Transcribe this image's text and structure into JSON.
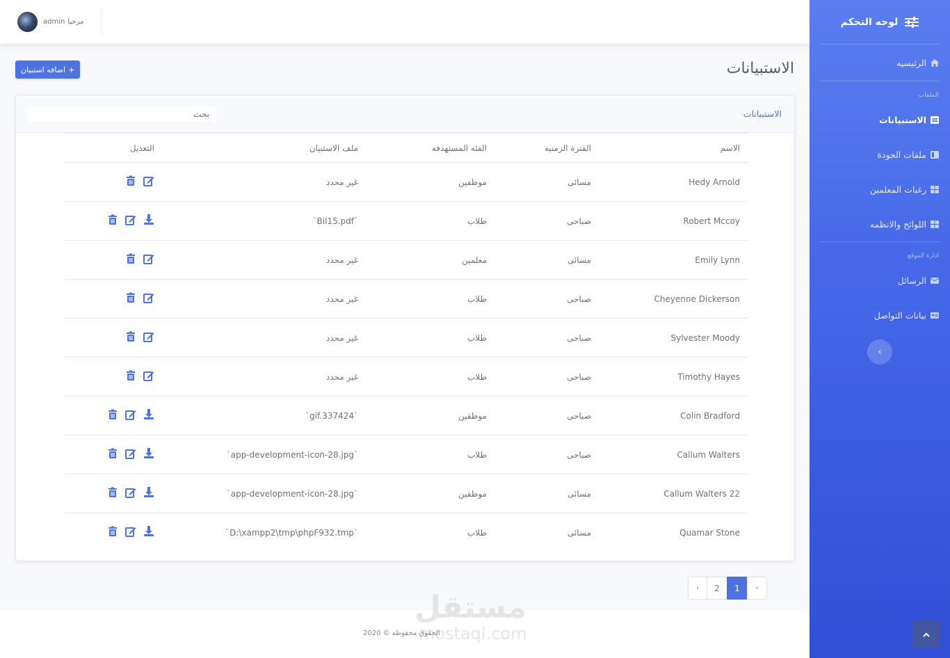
{
  "app": {
    "brand_label": "لوحه التحكم"
  },
  "sidebar": {
    "home_label": "الرئيسيه",
    "section_files": "الملفات",
    "items_files": [
      {
        "label": "الاستبيانات",
        "active": true,
        "icon": "list-icon"
      },
      {
        "label": "ملفات الجودة",
        "active": false,
        "icon": "file-icon"
      },
      {
        "label": "رغبات المعلمين",
        "active": false,
        "icon": "table-icon"
      },
      {
        "label": "اللوائح والانظمه",
        "active": false,
        "icon": "table-icon"
      }
    ],
    "section_site": "ادارة الموقع",
    "items_site": [
      {
        "label": "الرسائل",
        "icon": "envelope-icon"
      },
      {
        "label": "بيانات التواصل",
        "icon": "id-card-icon"
      }
    ],
    "toggle_symbol": "‹"
  },
  "topbar": {
    "greeting": "مرحبا",
    "username": "admin"
  },
  "page": {
    "title": "الاستبيانات",
    "add_button": "اضافه استبيان",
    "add_button_icon": "+"
  },
  "card": {
    "title": "الاستبيانات",
    "search_placeholder": "بحث"
  },
  "table": {
    "headers": {
      "name": "الاسم",
      "time": "الفترة الزمنيه",
      "target": "الفئه المستهدفه",
      "file": "ملف الاستبيان",
      "edit": "التعديل"
    },
    "rows": [
      {
        "name": "Hedy Arnold",
        "time": "مسائى",
        "target": "موظفين",
        "file": "غير محدد",
        "download": false
      },
      {
        "name": "Robert Mccoy",
        "time": "صباحى",
        "target": "طلاب",
        "file": "`Bil15.pdf`",
        "download": true
      },
      {
        "name": "Emily Lynn",
        "time": "مسائى",
        "target": "معلمين",
        "file": "غير محدد",
        "download": false
      },
      {
        "name": "Cheyenne Dickerson",
        "time": "صباحى",
        "target": "طلاب",
        "file": "غير محدد",
        "download": false
      },
      {
        "name": "Sylvester Moody",
        "time": "صباحى",
        "target": "طلاب",
        "file": "غير محدد",
        "download": false
      },
      {
        "name": "Timothy Hayes",
        "time": "صباحى",
        "target": "طلاب",
        "file": "غير محدد",
        "download": false
      },
      {
        "name": "Colin Bradford",
        "time": "صباحى",
        "target": "موظفين",
        "file": "`gif.337424`",
        "download": true
      },
      {
        "name": "Callum Walters",
        "time": "صباحى",
        "target": "طلاب",
        "file": "`app-development-icon-28.jpg`",
        "download": true
      },
      {
        "name": "Callum Walters 22",
        "time": "مسائى",
        "target": "موظفين",
        "file": "`app-development-icon-28.jpg`",
        "download": true
      },
      {
        "name": "Quamar Stone",
        "time": "مسائى",
        "target": "طلاب",
        "file": "`D:\\xampp2\\tmp\\phpF932.tmp`",
        "download": true
      }
    ]
  },
  "pagination": {
    "prev": "‹",
    "pages": [
      "1",
      "2"
    ],
    "current": "1",
    "next": "›"
  },
  "footer": {
    "copyright": "الحقوق محفوظه © 2020"
  },
  "watermark": {
    "arabic": "مستقل",
    "latin": "mostaql.com"
  },
  "colors": {
    "primary": "#4e73df",
    "sidebar_top": "#5a7ef0",
    "sidebar_bottom": "#2f4fd6",
    "text": "#6e707e"
  }
}
